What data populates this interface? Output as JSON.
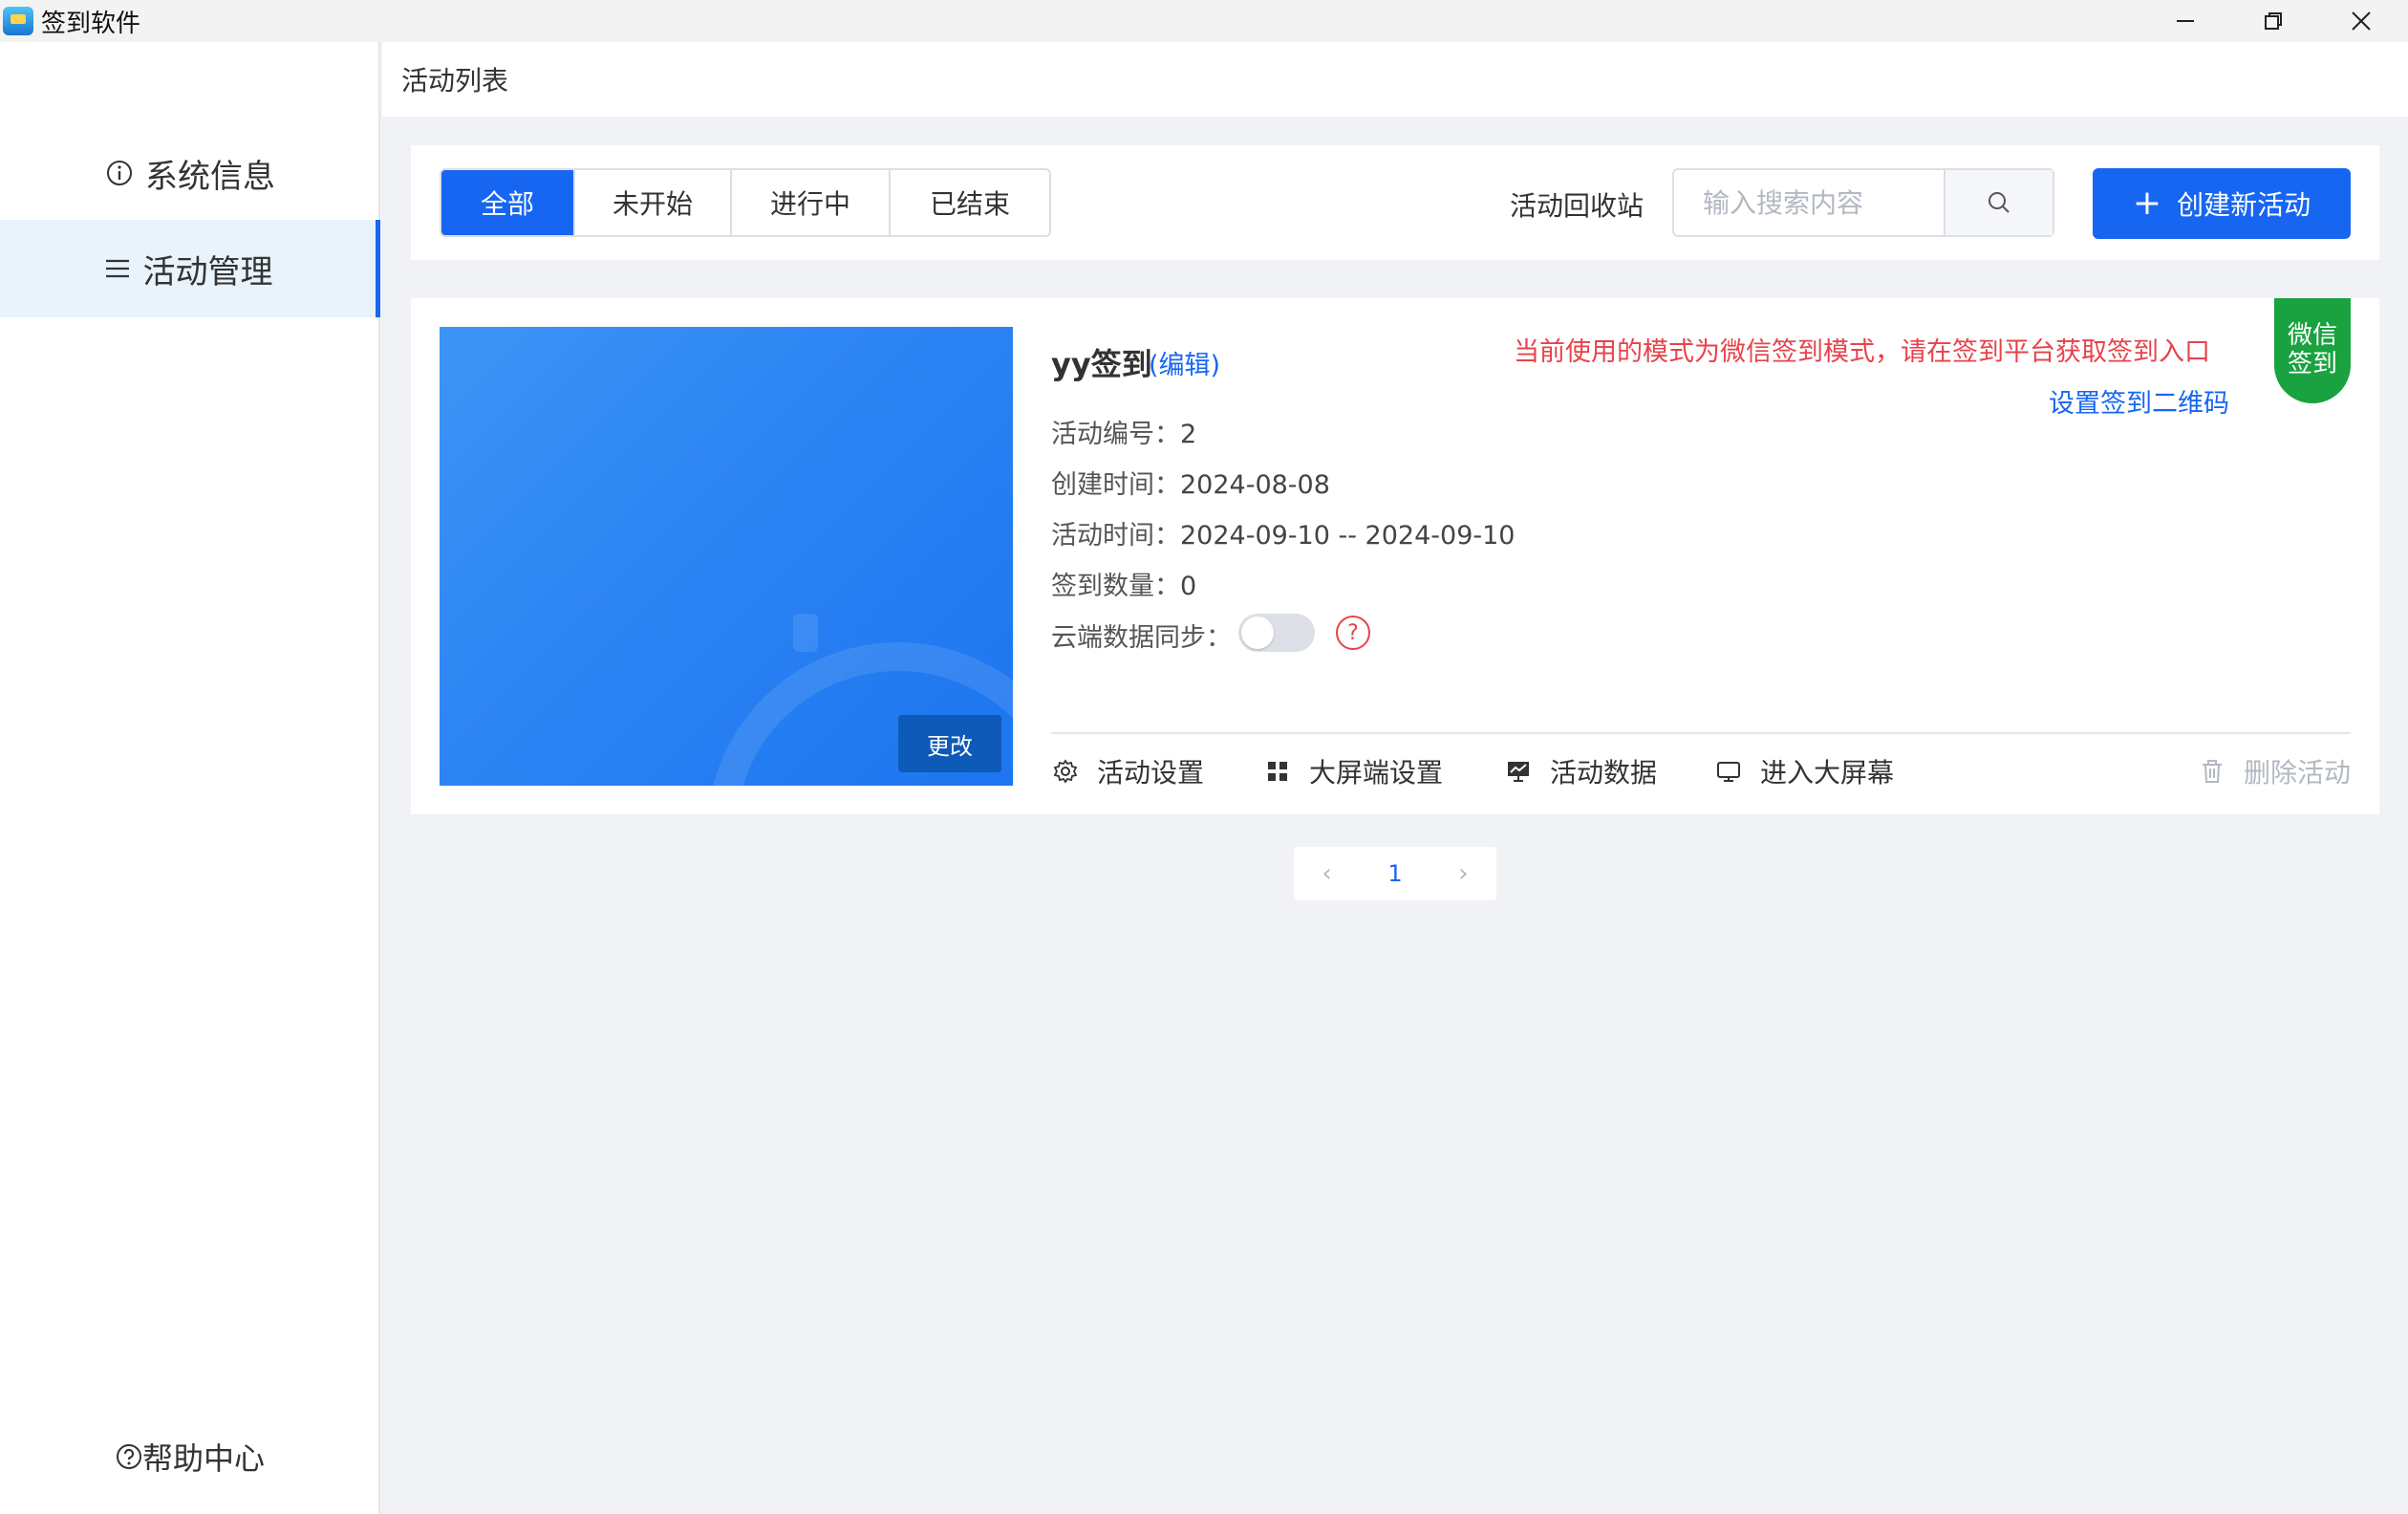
{
  "window": {
    "title": "签到软件",
    "minimize": "—",
    "maximize": "❐",
    "close": "✕"
  },
  "sidebar": {
    "items": [
      {
        "label": "系统信息",
        "icon": "info-icon"
      },
      {
        "label": "活动管理",
        "icon": "menu-icon",
        "active": true
      }
    ],
    "help": "帮助中心"
  },
  "header": {
    "title": "活动列表"
  },
  "toolbar": {
    "tabs": [
      {
        "label": "全部",
        "active": true
      },
      {
        "label": "未开始"
      },
      {
        "label": "进行中"
      },
      {
        "label": "已结束"
      }
    ],
    "recycle": "活动回收站",
    "search_placeholder": "输入搜索内容",
    "create_label": "创建新活动"
  },
  "activity": {
    "title": "yy签到",
    "edit": "(编辑)",
    "change_cover": "更改",
    "id_label": "活动编号：",
    "id": "2",
    "created_label": "创建时间：",
    "created": "2024-08-08",
    "period_label": "活动时间：",
    "period": "2024-09-10 -- 2024-09-10",
    "count_label": "签到数量：",
    "count": "0",
    "sync_label": "云端数据同步：",
    "sync_on": false,
    "help_mark": "?",
    "notice": "当前使用的模式为微信签到模式，请在签到平台获取签到入口",
    "qr_link": "设置签到二维码",
    "badge_line1": "微信",
    "badge_line2": "签到",
    "actions": {
      "settings": "活动设置",
      "screen_settings": "大屏端设置",
      "data": "活动数据",
      "enter_screen": "进入大屏幕",
      "delete": "删除活动"
    }
  },
  "pagination": {
    "prev": "‹",
    "current": "1",
    "next": "›"
  },
  "colors": {
    "primary": "#1766f2",
    "danger": "#e8424b",
    "wechat": "#19a23f"
  }
}
